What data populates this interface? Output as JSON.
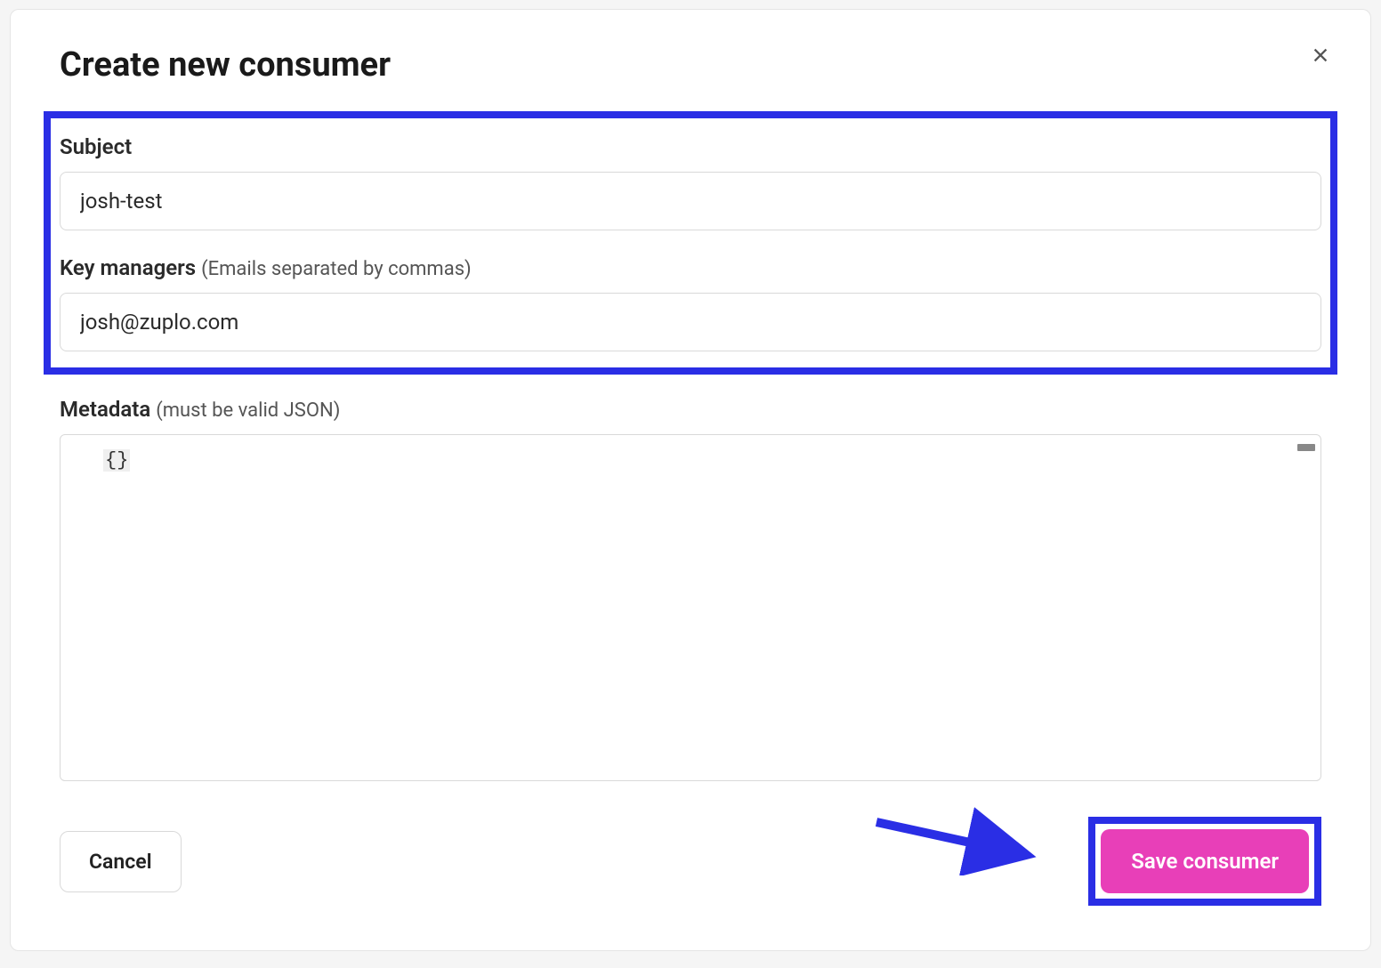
{
  "modal": {
    "title": "Create new consumer",
    "fields": {
      "subject": {
        "label": "Subject",
        "value": "josh-test"
      },
      "key_managers": {
        "label": "Key managers",
        "hint": "(Emails separated by commas)",
        "value": "josh@zuplo.com"
      },
      "metadata": {
        "label": "Metadata",
        "hint": "(must be valid JSON)",
        "value": "{}"
      }
    },
    "buttons": {
      "cancel": "Cancel",
      "save": "Save consumer"
    }
  }
}
